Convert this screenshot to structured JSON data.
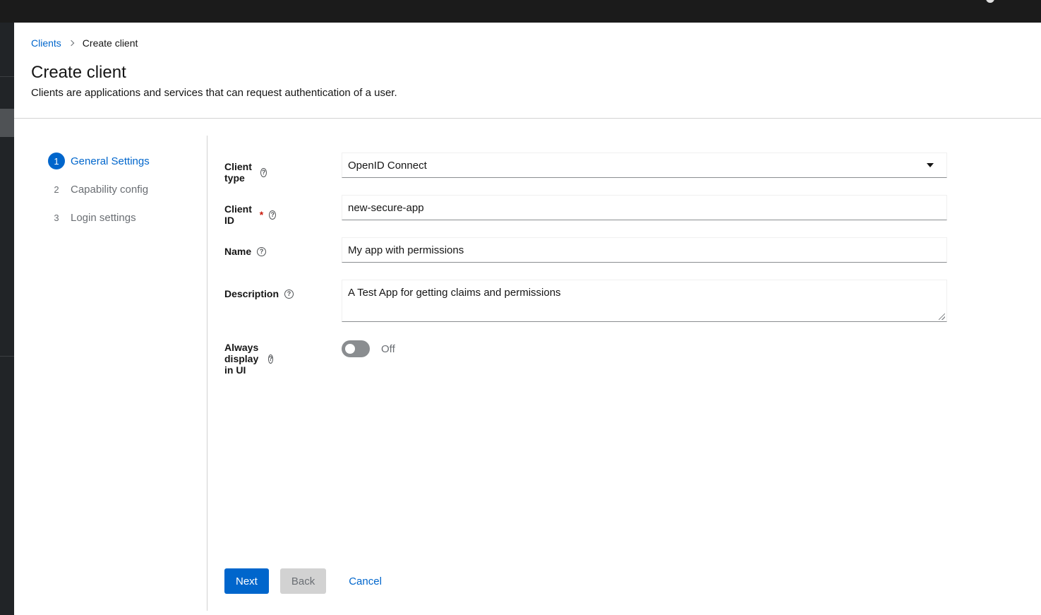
{
  "breadcrumb": {
    "parent": "Clients",
    "current": "Create client"
  },
  "page": {
    "title": "Create client",
    "description": "Clients are applications and services that can request authentication of a user."
  },
  "wizard": {
    "steps": [
      {
        "number": "1",
        "label": "General Settings",
        "active": true
      },
      {
        "number": "2",
        "label": "Capability config",
        "active": false
      },
      {
        "number": "3",
        "label": "Login settings",
        "active": false
      }
    ]
  },
  "form": {
    "client_type": {
      "label": "Client type",
      "value": "OpenID Connect"
    },
    "client_id": {
      "label": "Client ID",
      "required_mark": "*",
      "value": "new-secure-app"
    },
    "name": {
      "label": "Name",
      "value": "My app with permissions"
    },
    "description": {
      "label": "Description",
      "value": "A Test App for getting claims and permissions"
    },
    "always_display": {
      "label": "Always display in UI",
      "state_text": "Off",
      "on": false
    },
    "help_glyph": "?"
  },
  "footer": {
    "next": "Next",
    "back": "Back",
    "cancel": "Cancel"
  },
  "colors": {
    "primary": "#0066cc",
    "topbar": "#1b1b1b",
    "sidenav": "#212427",
    "required": "#c9190b"
  }
}
